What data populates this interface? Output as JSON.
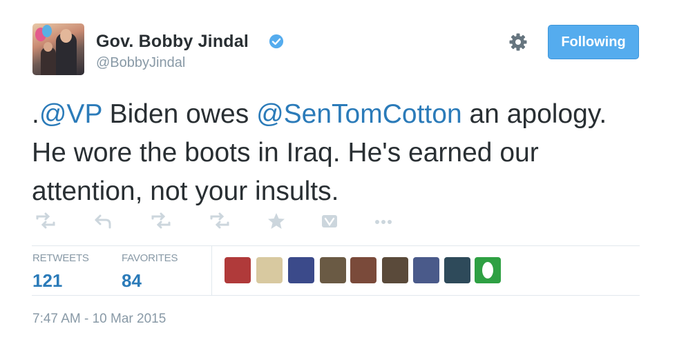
{
  "author": {
    "name": "Gov. Bobby Jindal",
    "handle": "@BobbyJindal",
    "verified": true,
    "avatar_icon": "profile-photo"
  },
  "header": {
    "settings_icon": "gear-icon",
    "follow_button_label": "Following"
  },
  "tweet": {
    "segments": [
      {
        "text": ".",
        "type": "text"
      },
      {
        "text": "@VP",
        "type": "mention"
      },
      {
        "text": " Biden owes ",
        "type": "text"
      },
      {
        "text": "@SenTomCotton",
        "type": "mention"
      },
      {
        "text": " an apology. He wore the boots in Iraq. He's earned our attention, not your insults.",
        "type": "text"
      }
    ]
  },
  "actions": [
    {
      "name": "retweet-icon-1"
    },
    {
      "name": "reply-icon"
    },
    {
      "name": "retweet-icon-2"
    },
    {
      "name": "retweet-icon-3"
    },
    {
      "name": "favorite-star-icon"
    },
    {
      "name": "vine-icon"
    },
    {
      "name": "more-icon"
    }
  ],
  "stats": {
    "retweets_label": "RETWEETS",
    "retweets_count": "121",
    "favorites_label": "FAVORITES",
    "favorites_count": "84"
  },
  "favoriters": [
    {
      "color": "#b03a3a"
    },
    {
      "color": "#d8c9a0"
    },
    {
      "color": "#3b4a8a"
    },
    {
      "color": "#6a5a44"
    },
    {
      "color": "#7a4a3a"
    },
    {
      "color": "#5a4a3a"
    },
    {
      "color": "#4a5a8a"
    },
    {
      "color": "#2e4a5a"
    },
    {
      "color": "#2ea043"
    }
  ],
  "timestamp": "7:47 AM - 10 Mar 2015",
  "colors": {
    "accent": "#55acee",
    "link": "#2b7bb9",
    "muted": "#8899a6",
    "text": "#292f33"
  }
}
